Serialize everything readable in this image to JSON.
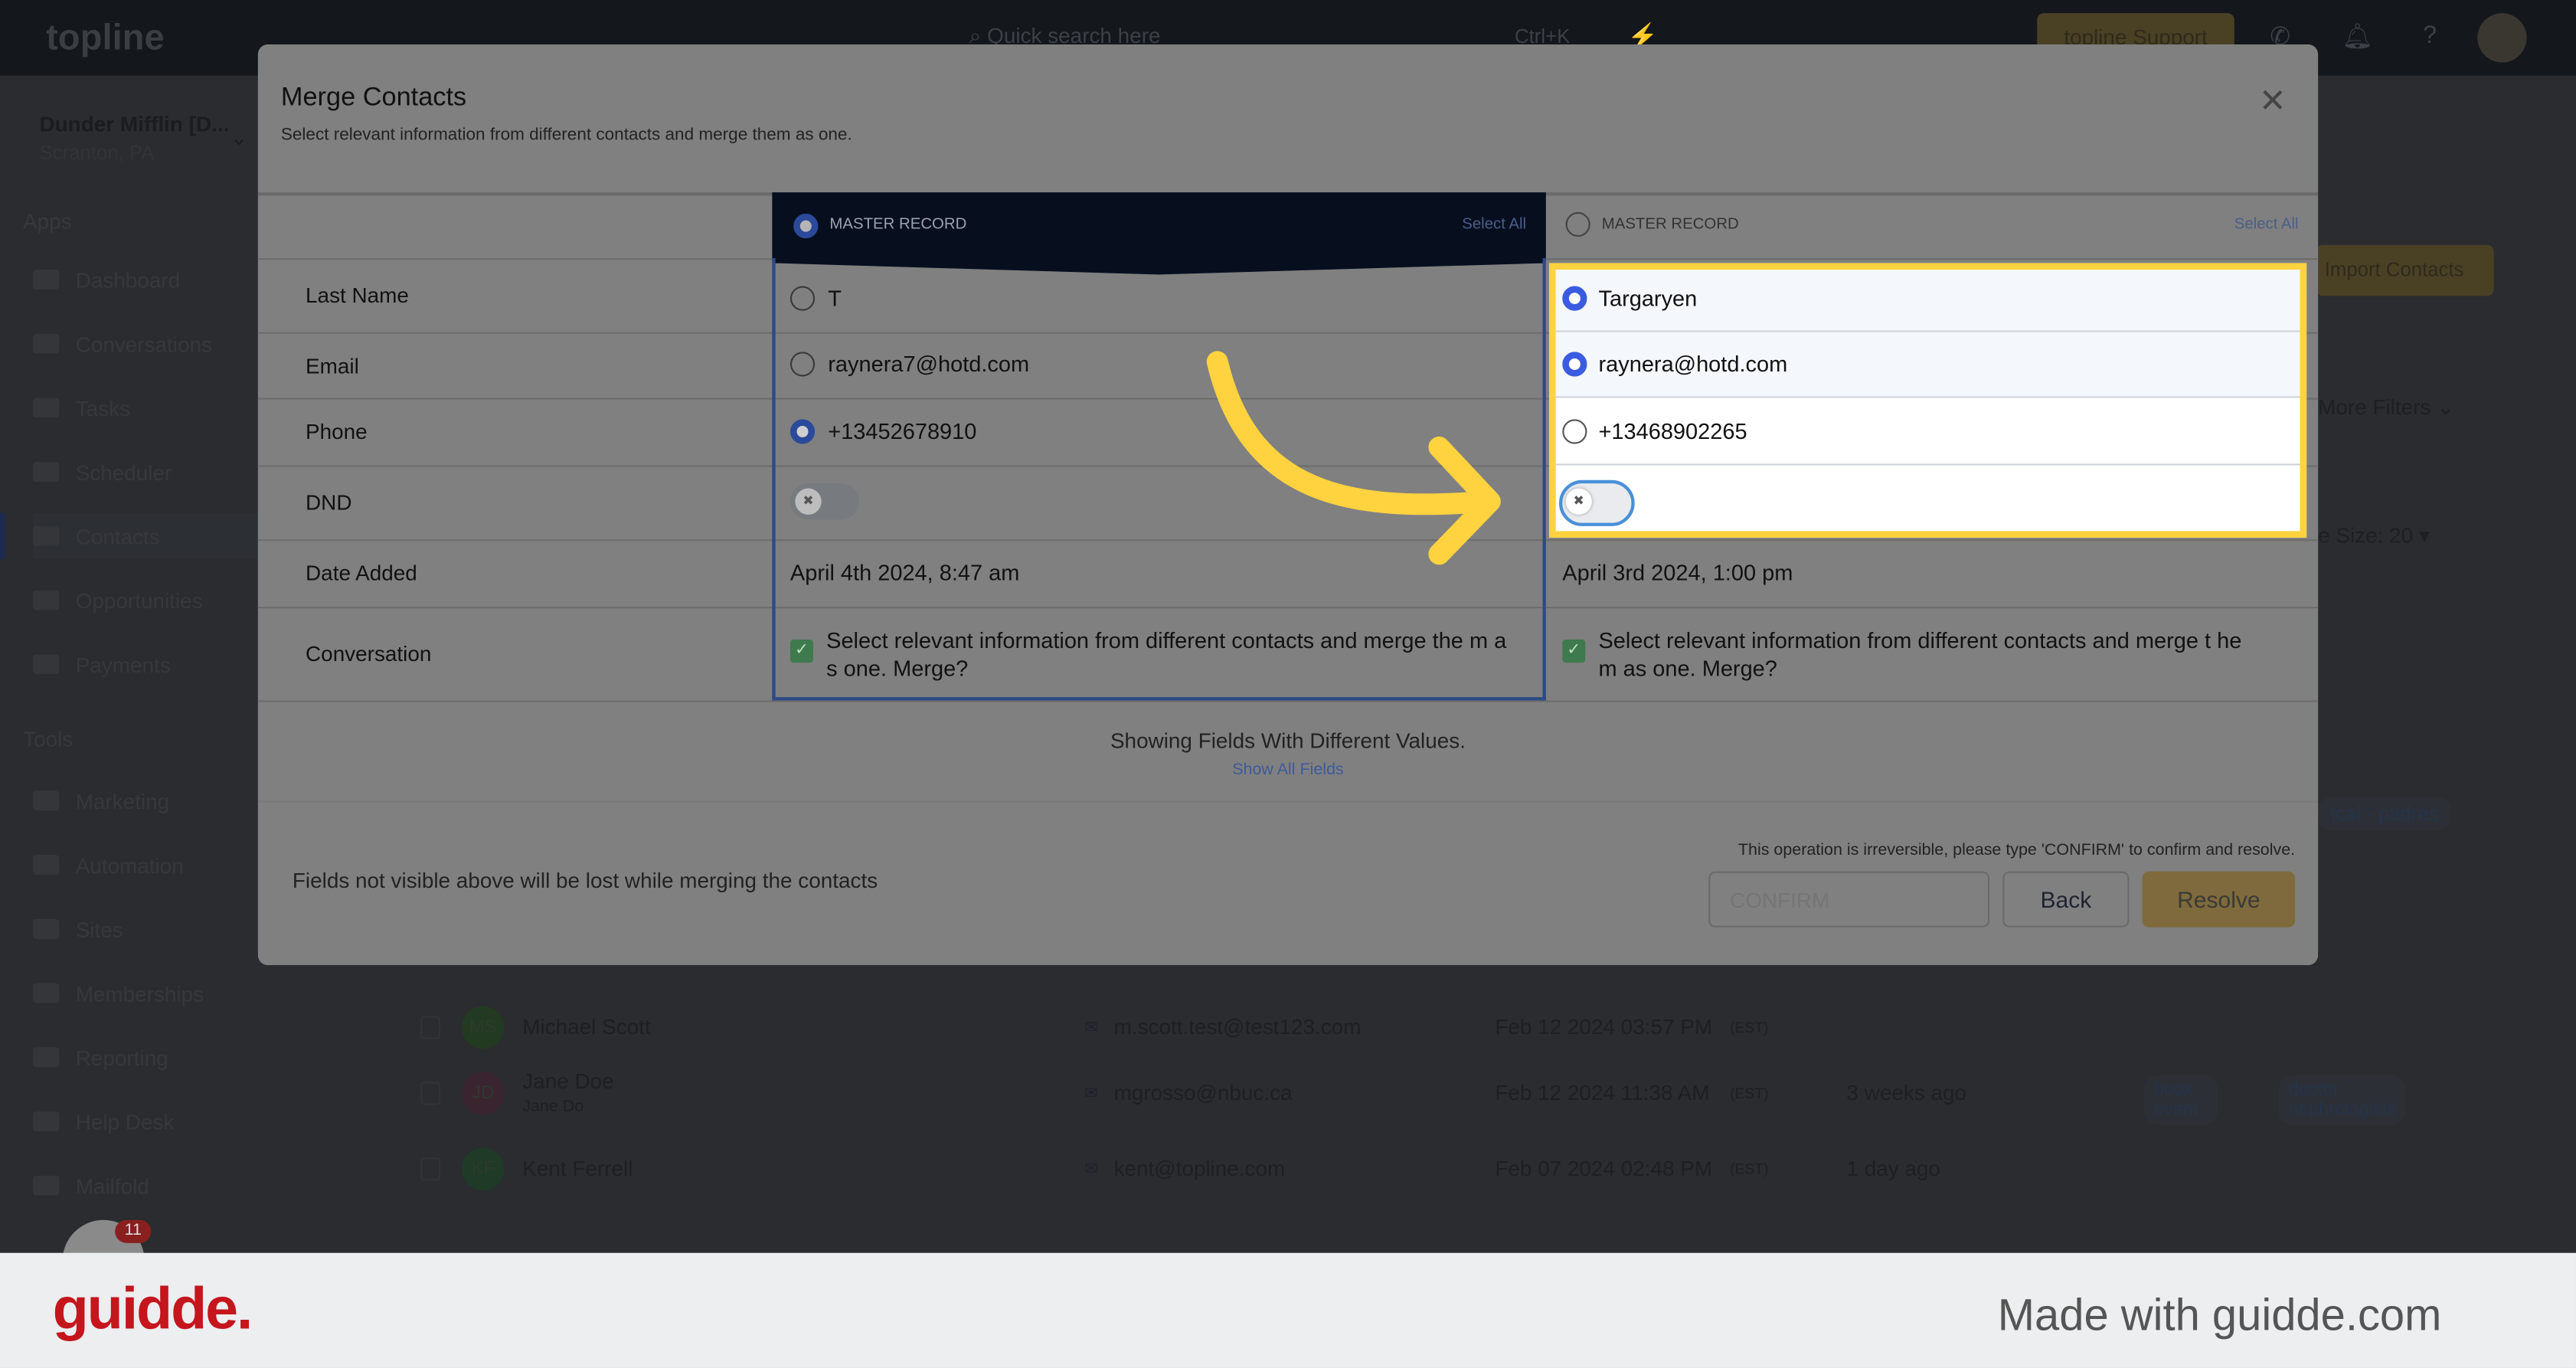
{
  "topbar": {
    "logo": "topline",
    "search_placeholder": "Quick search here",
    "shortcut": "Ctrl+K",
    "support_label": "topline Support"
  },
  "sidebar": {
    "org_name": "Dunder Mifflin [D...",
    "org_location": "Scranton, PA",
    "apps_label": "Apps",
    "tools_label": "Tools",
    "apps": [
      {
        "label": "Dashboard"
      },
      {
        "label": "Conversations"
      },
      {
        "label": "Tasks"
      },
      {
        "label": "Scheduler"
      },
      {
        "label": "Contacts"
      },
      {
        "label": "Opportunities"
      },
      {
        "label": "Payments"
      }
    ],
    "tools": [
      {
        "label": "Marketing"
      },
      {
        "label": "Automation"
      },
      {
        "label": "Sites"
      },
      {
        "label": "Memberships"
      },
      {
        "label": "Reporting"
      },
      {
        "label": "Help Desk"
      },
      {
        "label": "Mailfold"
      }
    ],
    "badge_count": "11"
  },
  "background": {
    "import_label": "Import Contacts",
    "more_filters": "More Filters",
    "page_size": "e Size: 20",
    "tag_partial": "ical - padres",
    "rows": [
      {
        "initials": "MS",
        "name": "Michael Scott",
        "sub": "",
        "email": "m.scott.test@test123.com",
        "date": "Feb 12 2024 03:57 PM",
        "tz": "(EST)",
        "activity": "",
        "tags": []
      },
      {
        "initials": "JD",
        "name": "Jane Doe",
        "sub": "Jane Do",
        "email": "mgrosso@nbuc.ca",
        "date": "Feb 12 2024 11:38 AM",
        "tz": "(EST)",
        "activity": "3 weeks ago",
        "tags": [
          "book event",
          "doctor-nephrologists"
        ]
      },
      {
        "initials": "KF",
        "name": "Kent Ferrell",
        "sub": "",
        "email": "kent@topline.com",
        "date": "Feb 07 2024 02:48 PM",
        "tz": "(EST)",
        "activity": "1 day ago",
        "tags": []
      }
    ]
  },
  "modal": {
    "title": "Merge Contacts",
    "subtitle": "Select relevant information from different contacts and merge them as one.",
    "fields": [
      "Last Name",
      "Email",
      "Phone",
      "DND",
      "Date Added",
      "Conversation"
    ],
    "records": [
      {
        "header": "MASTER RECORD",
        "select_all": "Select All",
        "master": true,
        "last_name": "T",
        "email": "raynera7@hotd.com",
        "phone": "+13452678910",
        "selected": {
          "last_name": false,
          "email": false,
          "phone": true
        },
        "dnd": false,
        "date_added": "April 4th 2024, 8:47 am",
        "conversation": "Select relevant information from different contacts and merge the m as one. Merge?"
      },
      {
        "header": "MASTER RECORD",
        "select_all": "Select All",
        "master": false,
        "last_name": "Targaryen",
        "email": "raynera@hotd.com",
        "phone": "+13468902265",
        "selected": {
          "last_name": true,
          "email": true,
          "phone": false
        },
        "dnd": false,
        "date_added": "April 3rd 2024, 1:00 pm",
        "conversation": "Select relevant information from different contacts and merge t hem as one. Merge?"
      }
    ],
    "showing_text": "Showing Fields With Different Values.",
    "show_all": "Show All Fields",
    "warning_left": "Fields not visible above will be lost while merging the contacts",
    "irreversible": "This operation is irreversible, please type 'CONFIRM' to confirm and resolve.",
    "confirm_placeholder": "CONFIRM",
    "back_label": "Back",
    "resolve_label": "Resolve"
  },
  "footer": {
    "brand": "guidde.",
    "made_with": "Made with guidde.com"
  },
  "colors": {
    "accent_yellow": "#ffd23f",
    "radio_blue": "#3b5be0",
    "brand_red": "#c4161c"
  }
}
